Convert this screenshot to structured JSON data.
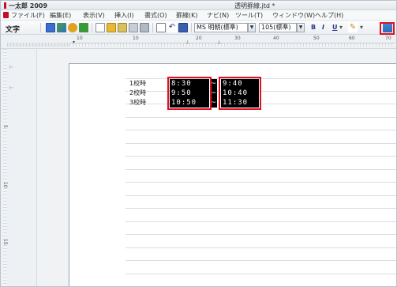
{
  "window": {
    "app_name": "一太郎 2009",
    "document_title": "透明罫線.jtd *"
  },
  "menu": [
    "ファイル(F)",
    "編集(E)",
    "表示(V)",
    "挿入(I)",
    "書式(O)",
    "罫線(K)",
    "ナビ(N)",
    "ツール(T)",
    "ウィンドウ(W)",
    "ヘルプ(H)"
  ],
  "toolbar": {
    "mode_label": "文字",
    "font_name": "MS 明朝(標準)",
    "font_size": "105(標準)",
    "bold": "B",
    "italic": "I",
    "underline": "U"
  },
  "ruler": {
    "marks": [
      "10",
      "10",
      "20",
      "30",
      "40",
      "50",
      "60",
      "70"
    ],
    "vertical_marks": [
      "5",
      "10",
      "15"
    ]
  },
  "timetable": [
    {
      "period": "1校時",
      "start": "8:30",
      "end": "9:40"
    },
    {
      "period": "2校時",
      "start": "9:50",
      "end": "10:40"
    },
    {
      "period": "3校時",
      "start": "10:50",
      "end": "11:30"
    }
  ],
  "separator": "~",
  "colors": {
    "highlight": "#e01020",
    "accent": "#c0102a",
    "cell_background": "#000000",
    "cell_text": "#ffffff"
  }
}
